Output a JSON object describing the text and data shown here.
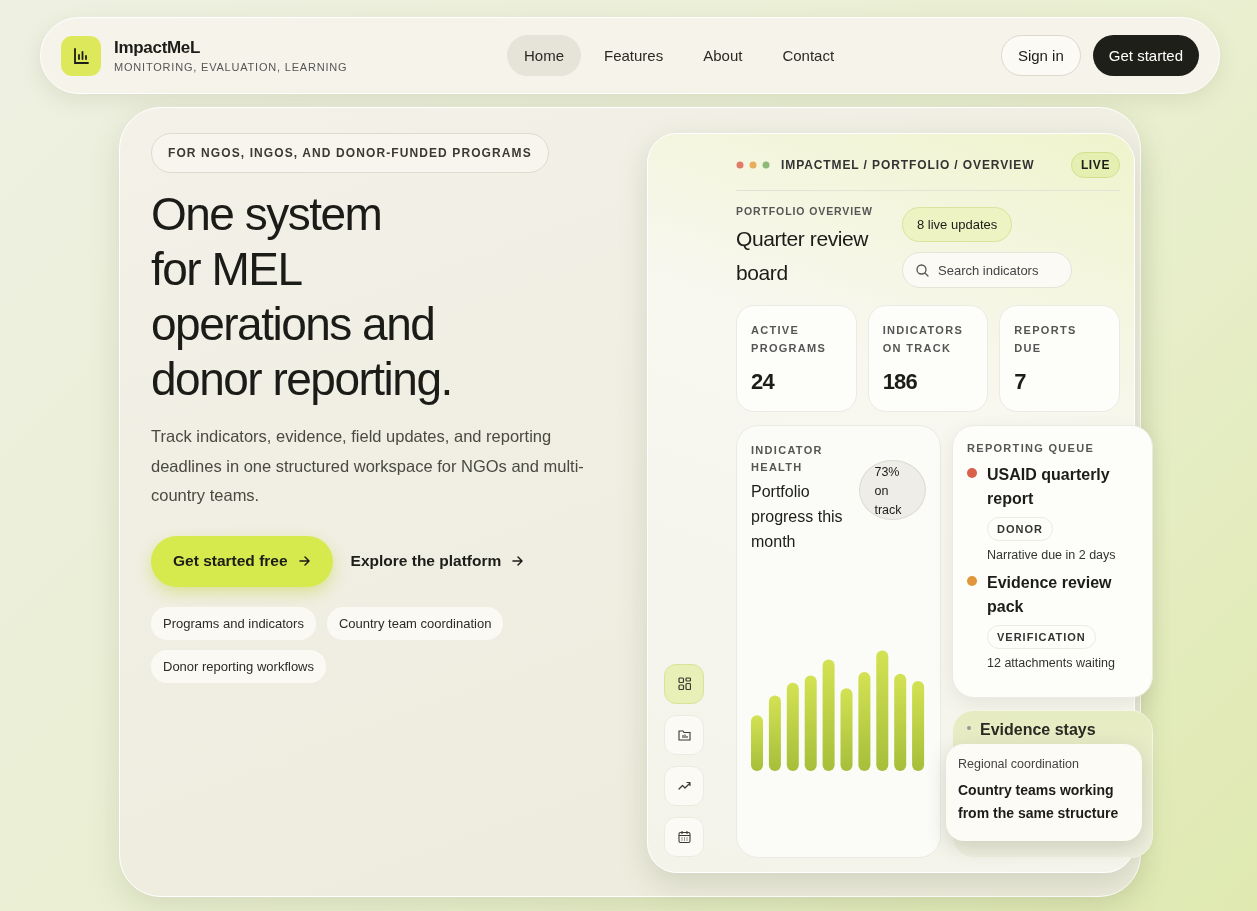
{
  "nav": {
    "brand": "ImpactMeL",
    "tagline": "MONITORING, EVALUATION, LEARNING",
    "links": [
      {
        "label": "Home",
        "selected": true
      },
      {
        "label": "Features",
        "selected": false
      },
      {
        "label": "About",
        "selected": false
      },
      {
        "label": "Contact",
        "selected": false
      }
    ],
    "sign_in": "Sign in",
    "cta": "Get started"
  },
  "hero": {
    "eyebrow": "FOR NGOS, INGOS, AND DONOR-FUNDED PROGRAMS",
    "heading_lines": [
      "One system",
      "for MEL",
      "operations and",
      "donor reporting."
    ],
    "lead": "Track indicators, evidence, field updates, and reporting deadlines in one structured workspace for NGOs and multi-country teams.",
    "primary": "Get started free",
    "secondary": "Explore the platform",
    "chips": [
      "Programs and indicators",
      "Country team coordination",
      "Donor reporting workflows"
    ]
  },
  "dashboard": {
    "breadcrumb": "IMPACTMEL / PORTFOLIO / OVERVIEW",
    "live": "LIVE",
    "eyebrow": "PORTFOLIO OVERVIEW",
    "title": "Quarter review board",
    "updates": "8 live updates",
    "search": {
      "placeholder": "Search indicators"
    },
    "rail_icons": [
      {
        "kind": "grid",
        "selected": true
      },
      {
        "kind": "folder",
        "selected": false
      },
      {
        "kind": "trend",
        "selected": false
      },
      {
        "kind": "calendar",
        "selected": false
      }
    ],
    "stats": [
      {
        "label": "ACTIVE PROGRAMS",
        "value": "24"
      },
      {
        "label": "INDICATORS ON TRACK",
        "value": "186"
      },
      {
        "label": "REPORTS DUE",
        "value": "7"
      }
    ],
    "health": {
      "eyebrow": "INDICATOR HEALTH",
      "title": "Portfolio progress this month",
      "badge": "73% on track"
    },
    "queue": {
      "eyebrow": "REPORTING QUEUE",
      "items": [
        {
          "title": "USAID quarterly report",
          "tag": "DONOR",
          "note": "Narrative due in 2 days",
          "color": "#d9614c"
        },
        {
          "title": "Evidence review pack",
          "tag": "VERIFICATION",
          "note": "12 attachments waiting",
          "color": "#e0963a"
        }
      ]
    },
    "evidence": {
      "title": "Evidence stays"
    },
    "popup": {
      "eyebrow": "Regional coordination",
      "title": "Country teams working from the same structure"
    }
  }
}
